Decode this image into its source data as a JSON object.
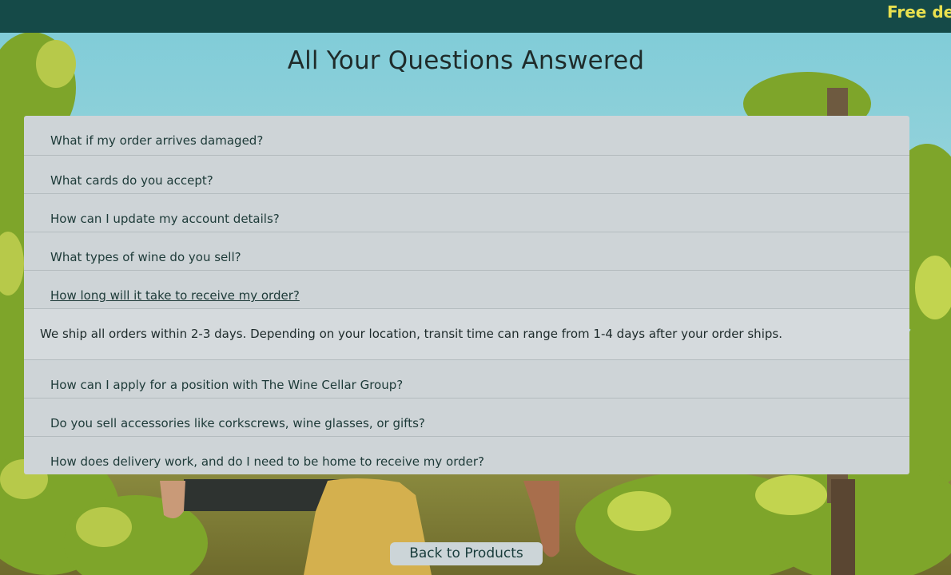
{
  "banner": {
    "promo_text": "Free de",
    "bg_color": "#154a48",
    "text_color": "#e9e04f"
  },
  "page": {
    "title": "All Your Questions Answered",
    "background_image": "vineyard-scene"
  },
  "faq": {
    "items": [
      {
        "question": "What if my order arrives damaged?"
      },
      {
        "question": "What cards do you accept?"
      },
      {
        "question": "How can I update my account details?"
      },
      {
        "question": "What types of wine do you sell?"
      },
      {
        "question": "How long will it take to receive my order?",
        "expanded": true,
        "answer": "We ship all orders within 2-3 days. Depending on your location, transit time can range from 1-4 days after your order ships."
      },
      {
        "question": "How can I apply for a position with The Wine Cellar Group?"
      },
      {
        "question": "Do you sell accessories like corkscrews, wine glasses, or gifts?"
      },
      {
        "question": "How does delivery work, and do I need to be home to receive my order?"
      }
    ]
  },
  "actions": {
    "back_label": "Back to Products"
  }
}
